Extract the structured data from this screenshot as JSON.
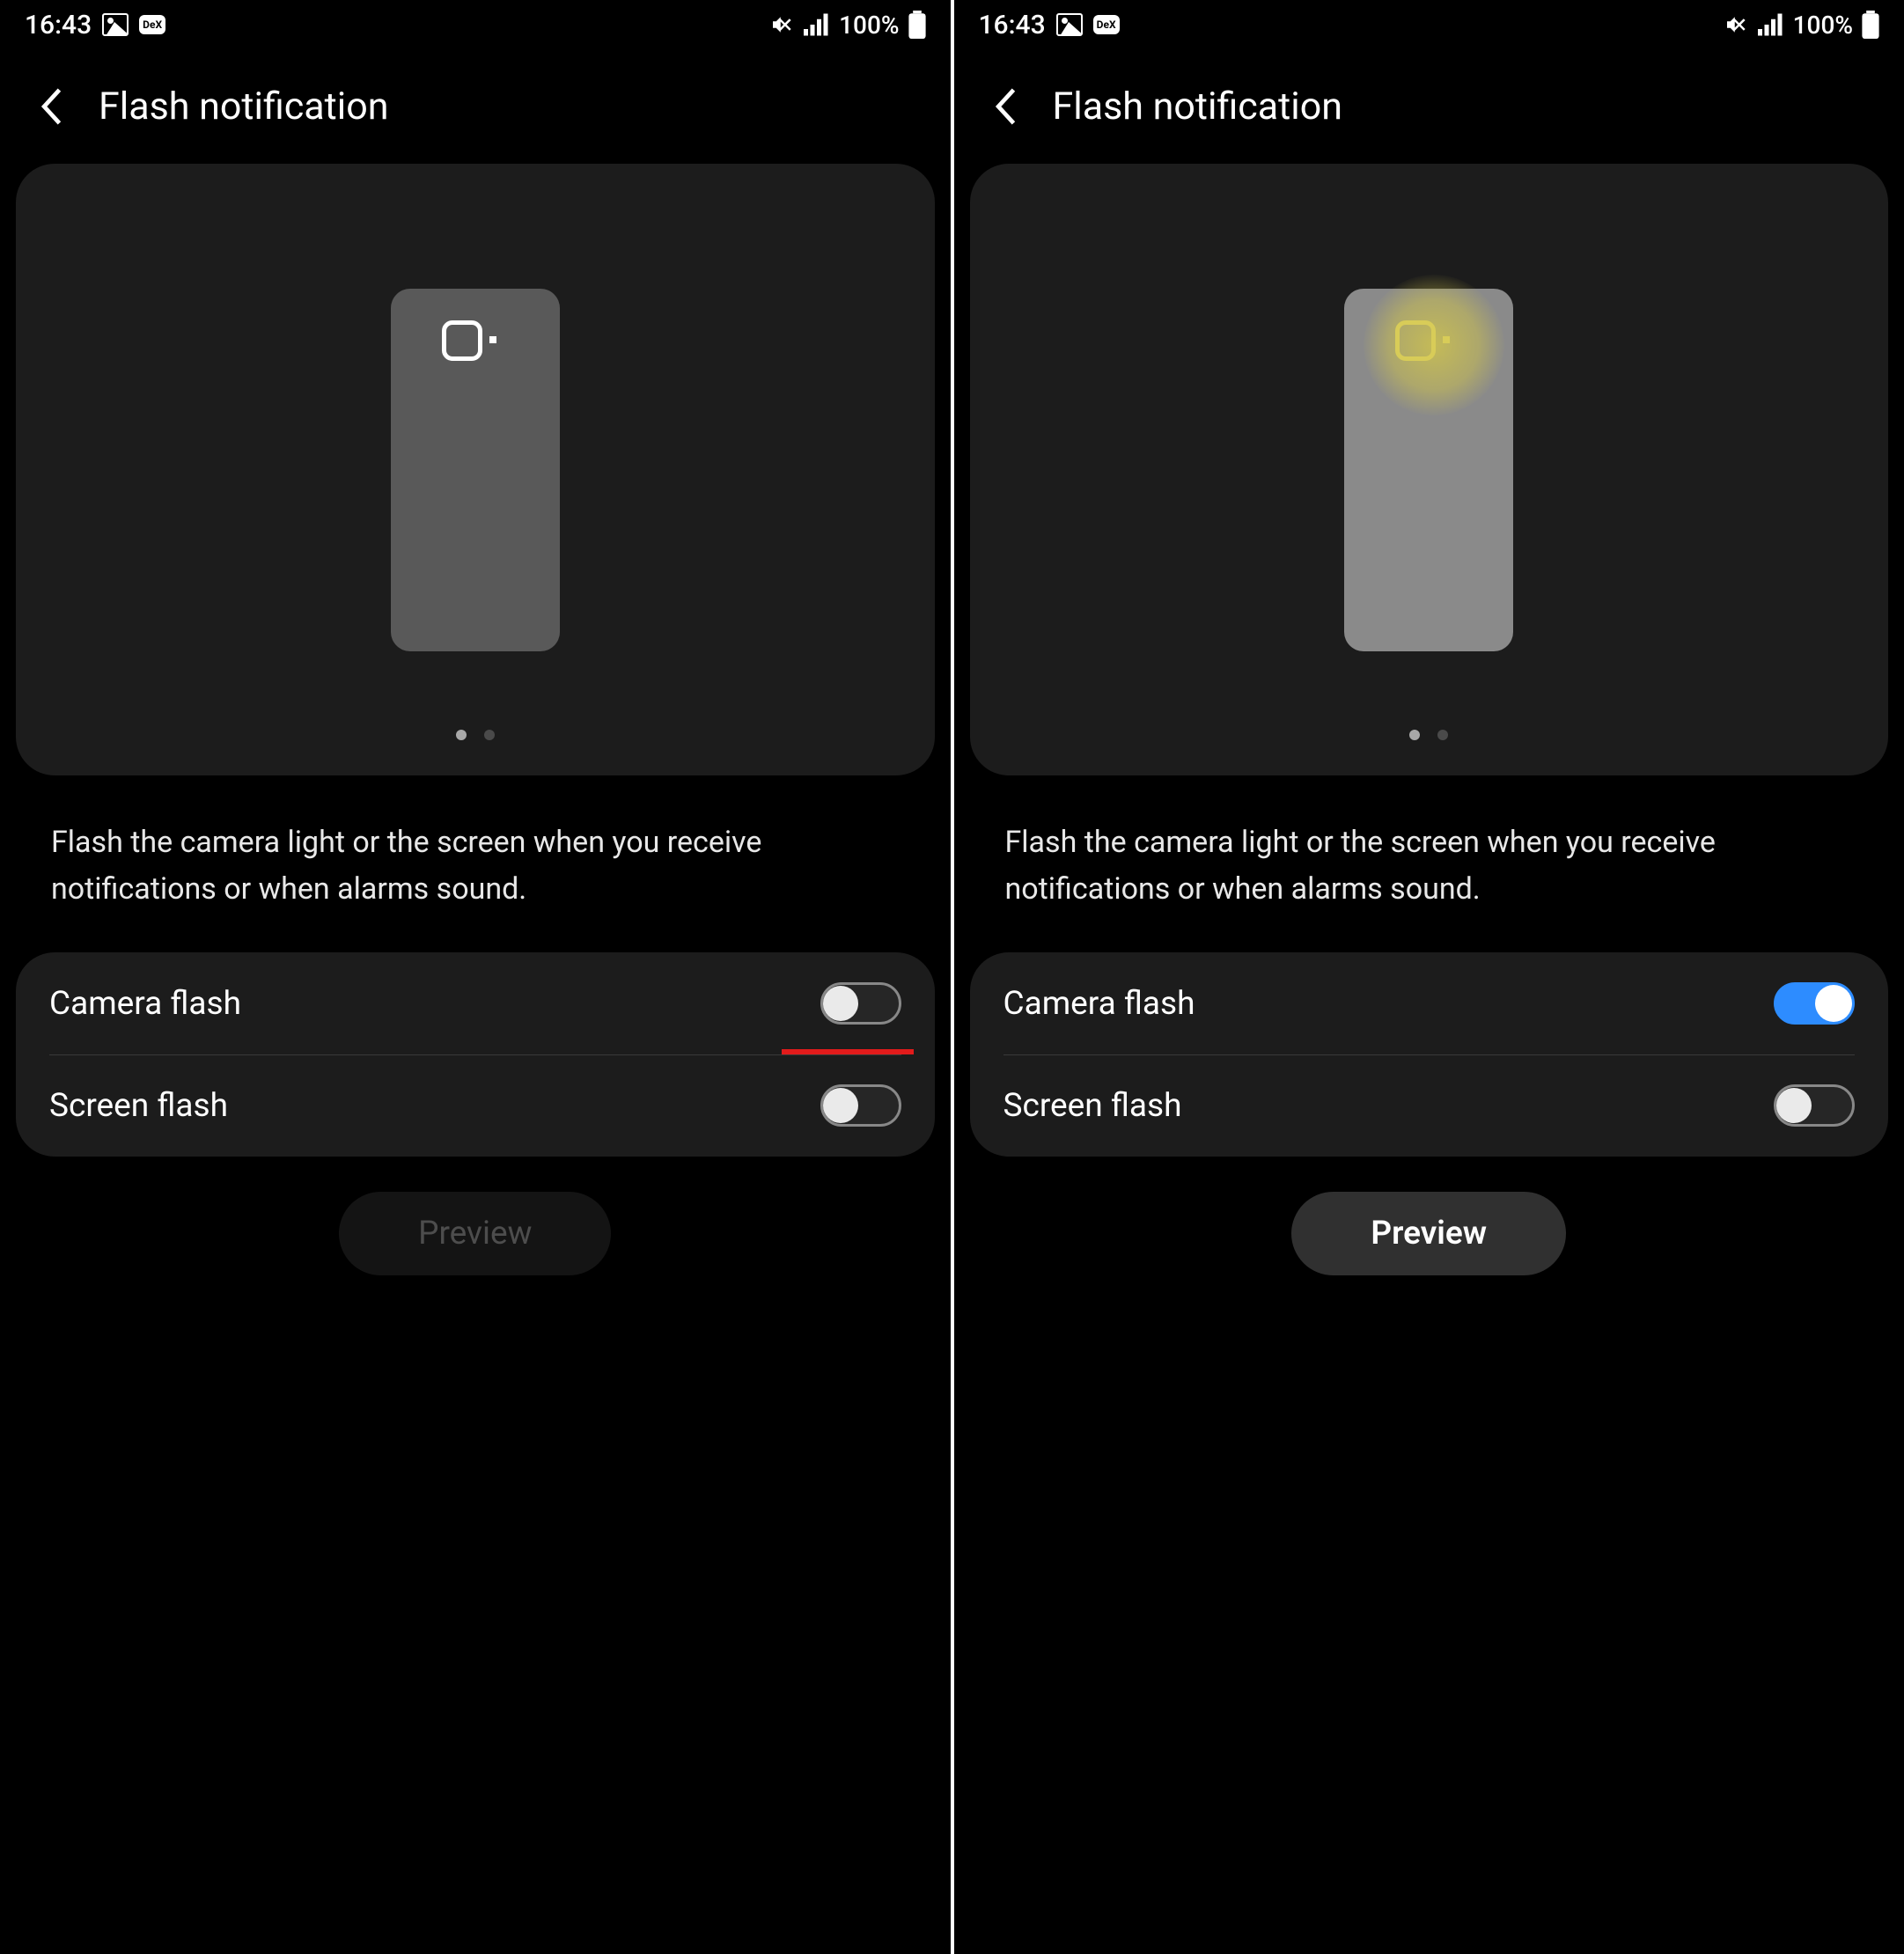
{
  "statusbar": {
    "time": "16:43",
    "battery_text": "100%"
  },
  "header": {
    "title": "Flash notification"
  },
  "description": "Flash the camera light or the screen when you receive notifications or when alarms sound.",
  "rows": {
    "camera_flash": "Camera flash",
    "screen_flash": "Screen flash"
  },
  "preview_button": "Preview",
  "screens": [
    {
      "camera_flash_on": false,
      "screen_flash_on": false,
      "preview_enabled": false,
      "show_glow": false,
      "annotate_underline": true
    },
    {
      "camera_flash_on": true,
      "screen_flash_on": false,
      "preview_enabled": true,
      "show_glow": true,
      "annotate_underline": false
    }
  ]
}
